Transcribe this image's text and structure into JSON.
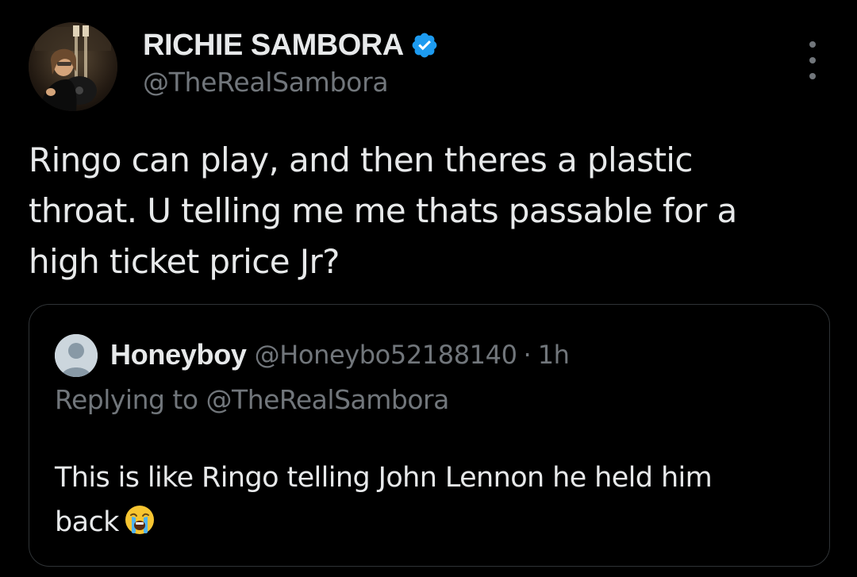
{
  "author": {
    "name": "RICHIE SAMBORA",
    "handle": "@TheRealSambora",
    "verified": true
  },
  "tweet": {
    "lines": [
      "Ringo can play, and then theres a plastic",
      "throat. U telling me me thats passable for a",
      "high ticket price Jr?"
    ]
  },
  "quoted": {
    "name": "Honeyboy",
    "handle": "@Honeybo52188140",
    "separator": "·",
    "time": "1h",
    "replying_prefix": "Replying to",
    "replying_handle": "@TheRealSambora",
    "lines": [
      "This is like Ringo telling John Lennon he held him",
      "back"
    ],
    "emoji": "loudly-crying-face"
  },
  "icons": {
    "verified": "verified-badge-icon",
    "more": "more-options-icon",
    "default_avatar": "default-avatar-icon"
  },
  "colors": {
    "background": "#000000",
    "primary_text": "#e7e9ea",
    "secondary_text": "#71767b",
    "verified_blue": "#1d9bf0",
    "border": "#2f3336"
  }
}
